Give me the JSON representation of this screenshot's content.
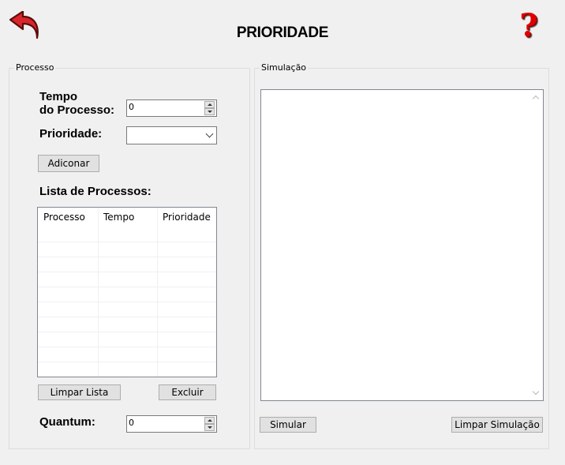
{
  "header": {
    "title": "PRIORIDADE",
    "back_icon": "back-arrow-icon",
    "help_icon": "help-question-icon",
    "help_glyph": "?",
    "accent_color": "#e00000"
  },
  "process_group": {
    "legend": "Processo",
    "tempo_label_line1": "Tempo",
    "tempo_label_line2": "do Processo:",
    "tempo_value": "0",
    "prioridade_label": "Prioridade:",
    "prioridade_value": "",
    "add_button": "Adiconar",
    "list_title": "Lista de Processos:",
    "table": {
      "columns": [
        "Processo",
        "Tempo",
        "Prioridade"
      ],
      "rows": []
    },
    "clear_list_button": "Limpar Lista",
    "delete_button": "Excluir",
    "quantum_label": "Quantum:",
    "quantum_value": "0"
  },
  "simulation_group": {
    "legend": "Simulação",
    "output_text": "",
    "simulate_button": "Simular",
    "clear_simulation_button": "Limpar Simulação"
  }
}
